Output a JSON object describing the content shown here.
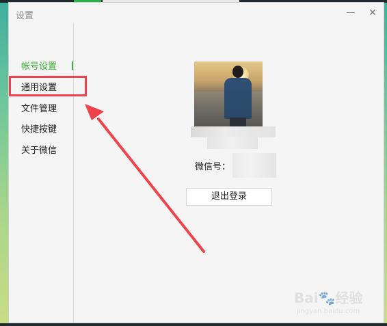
{
  "window": {
    "title": "设置",
    "minimize_glyph": "—",
    "close_glyph": "✕"
  },
  "sidebar": {
    "items": [
      {
        "label": "帐号设置",
        "active": true
      },
      {
        "label": "通用设置",
        "active": false
      },
      {
        "label": "文件管理",
        "active": false
      },
      {
        "label": "快捷按键",
        "active": false
      },
      {
        "label": "关于微信",
        "active": false
      }
    ]
  },
  "account": {
    "wechat_id_label": "微信号：",
    "logout_label": "退出登录"
  },
  "watermark": {
    "url": "jingyan.baidu.com"
  },
  "colors": {
    "accent": "#3cb034",
    "annotation": "#f0424a"
  }
}
